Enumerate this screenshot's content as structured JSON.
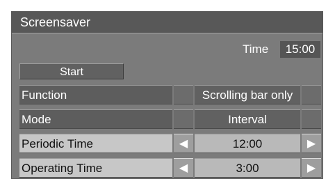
{
  "window": {
    "title": "Screensaver"
  },
  "time": {
    "label": "Time",
    "value": "15:00"
  },
  "start": {
    "label": "Start"
  },
  "rows": [
    {
      "label": "Function",
      "value": "Scrolling bar only"
    },
    {
      "label": "Mode",
      "value": "Interval"
    },
    {
      "label": "Periodic Time",
      "value": "12:00"
    },
    {
      "label": "Operating Time",
      "value": "3:00"
    }
  ],
  "icons": {
    "left_arrow": "triangle-left-icon",
    "right_arrow": "triangle-right-icon"
  },
  "colors": {
    "panel": "#7b7b7b",
    "title_bar": "#585858",
    "selected_row": "#c7c7c7"
  }
}
